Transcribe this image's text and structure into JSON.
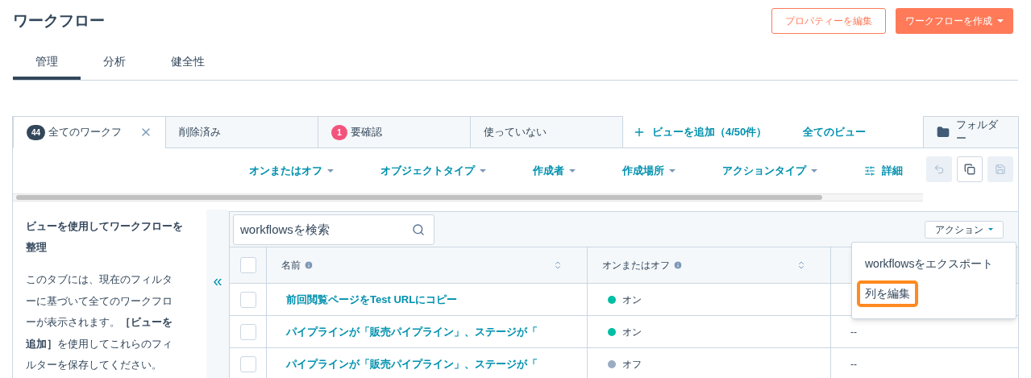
{
  "header": {
    "title": "ワークフロー",
    "buttons": [
      {
        "label": "プロパティーを編集",
        "kind": "secondary"
      },
      {
        "label": "ワークフローを作成",
        "kind": "primary"
      }
    ]
  },
  "nav_tabs": [
    {
      "label": "管理",
      "selected": true
    },
    {
      "label": "分析",
      "selected": false
    },
    {
      "label": "健全性",
      "selected": false
    }
  ],
  "view_tabs": [
    {
      "label": "全てのワークフ",
      "badge": "44",
      "color": "#33475b",
      "closable": true,
      "selected": true
    },
    {
      "label": "削除済み",
      "closable": false,
      "selected": false
    },
    {
      "label": "要確認",
      "badge": "1",
      "color": "#f2547d",
      "closable": false,
      "selected": false
    },
    {
      "label": "使っていない",
      "closable": false,
      "selected": false
    }
  ],
  "add_view": "ビューを追加（4/50件）",
  "all_views": "全てのビュー",
  "folder_button": "フォルダー",
  "filters": [
    "オンまたはオフ",
    "オブジェクトタイプ",
    "作成者",
    "作成場所",
    "アクションタイプ"
  ],
  "advanced_filter": "詳細",
  "tools": [
    {
      "kind": "undo",
      "disabled": true
    },
    {
      "kind": "clone",
      "disabled": false
    },
    {
      "kind": "save",
      "disabled": true
    }
  ],
  "sidebar": {
    "heading": "ビューを使用してワークフローを整理",
    "body": "このタブには、現在のフィルターに基づいて全てのワークフローが表示されます。**［ビューを追加］**を使用してこれらのフィルターを保存してください。"
  },
  "collapse_button": "«",
  "search": {
    "placeholder": "workflowsを検索"
  },
  "actions_button": "アクション",
  "table": {
    "select_all": {
      "checked": false
    },
    "columns": [
      {
        "label": "名前",
        "info": true,
        "sortable": true
      },
      {
        "label": "オンまたはオフ",
        "info": true,
        "sortable": true
      }
    ],
    "rows": [
      {
        "checked": false,
        "name": "前回閲覧ページをTest URLにコピー",
        "status": "オン",
        "on": true
      },
      {
        "checked": false,
        "name": "パイプラインが「販売パイプライン」、ステージが「",
        "status": "オン",
        "on": true,
        "column_3": "--"
      },
      {
        "checked": false,
        "name": "パイプラインが「販売パイプライン」、ステージが「",
        "status": "オフ",
        "on": false,
        "column_3": "--"
      }
    ]
  },
  "menu": {
    "items": [
      {
        "label": "workflowsをエクスポート",
        "highlighted": false
      },
      {
        "label": "列を編集",
        "highlighted": true
      }
    ]
  }
}
